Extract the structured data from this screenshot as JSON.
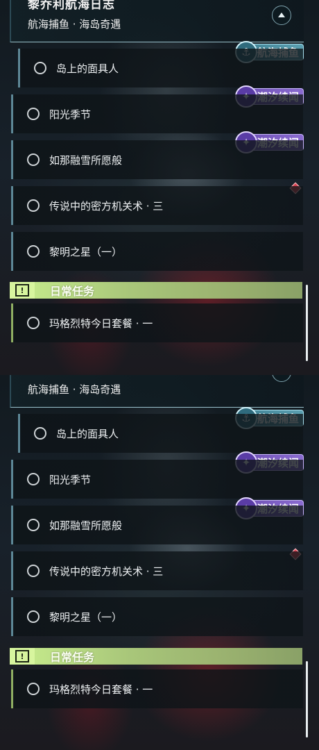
{
  "panels": [
    {
      "header": {
        "title": "黎乔利航海日志",
        "subtitle": "航海捕鱼 · 海岛奇遇"
      },
      "quests": [
        {
          "label": "岛上的面具人",
          "tag": "航海捕鱼"
        },
        {
          "label": "阳光季节",
          "tag": "潮汐续闻"
        },
        {
          "label": "如那融雪所愿般",
          "tag": "潮汐续闻"
        },
        {
          "label": "传说中的密方机关术 · 三"
        },
        {
          "label": "黎明之星（一）"
        }
      ],
      "section": {
        "icon": "!",
        "label": "日常任务"
      },
      "daily": [
        {
          "label": "玛格烈特今日套餐 · 一"
        }
      ]
    },
    {
      "header": {
        "subtitle": "航海捕鱼 · 海岛奇遇"
      },
      "quests": [
        {
          "label": "岛上的面具人",
          "tag": "航海捕鱼"
        },
        {
          "label": "阳光季节",
          "tag": "潮汐续闻"
        },
        {
          "label": "如那融雪所愿般",
          "tag": "潮汐续闻"
        },
        {
          "label": "传说中的密方机关术 · 三"
        },
        {
          "label": "黎明之星（一）"
        }
      ],
      "section": {
        "icon": "!",
        "label": "日常任务"
      },
      "daily": [
        {
          "label": "玛格烈特今日套餐 · 一"
        }
      ]
    }
  ],
  "colors": {
    "tide_tag": "#8a6bd0",
    "fish_tag": "#5b9fb0",
    "section": "#c9ef8e",
    "alert": "#d8404f"
  },
  "icons": {
    "collapse": "chevron-up-icon",
    "radio": "radio-empty-icon",
    "section": "exclamation-icon",
    "alert": "diamond-alert-icon"
  }
}
